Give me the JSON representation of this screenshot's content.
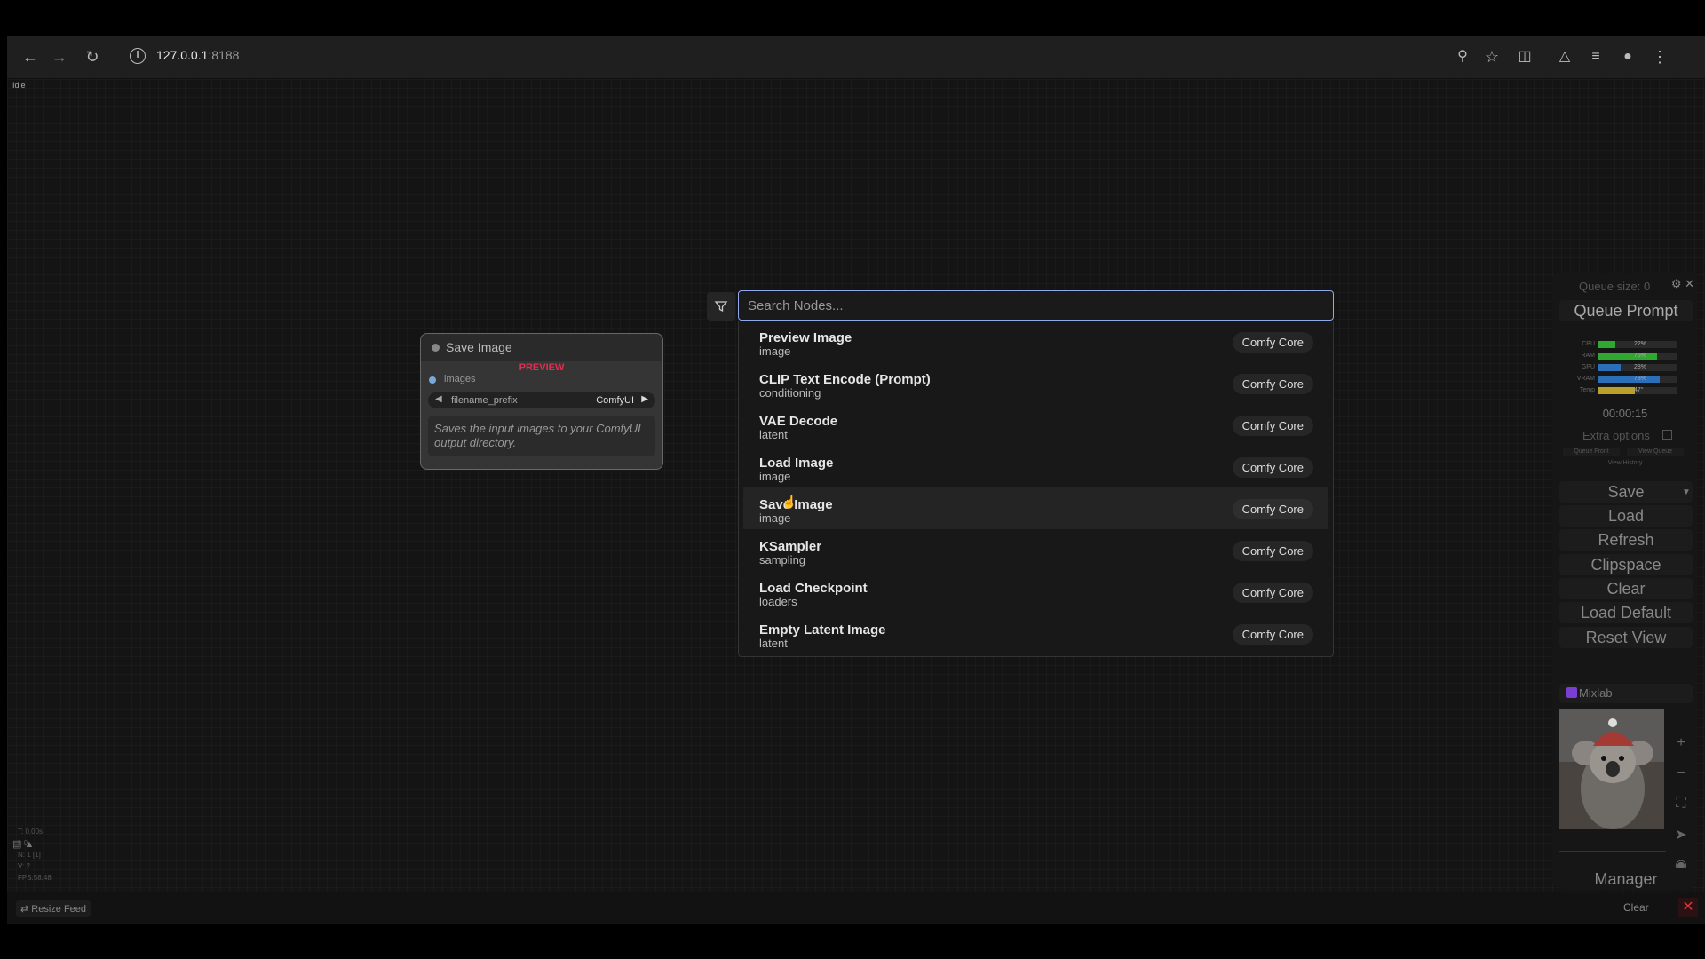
{
  "browser": {
    "url_host": "127.0.0.1",
    "url_port": ":8188",
    "icons": [
      "back-icon",
      "forward-icon",
      "reload-icon",
      "site-info-icon",
      "zoom-icon",
      "bookmark-star-icon",
      "extensions-icon",
      "labs-icon",
      "media-icon",
      "profile-icon",
      "menu-icon"
    ]
  },
  "status": {
    "idle": "Idle"
  },
  "node": {
    "title": "Save Image",
    "preview_label": "PREVIEW",
    "input_label": "images",
    "widget_name": "filename_prefix",
    "widget_value": "ComfyUI",
    "description": "Saves the input images to your ComfyUI output directory."
  },
  "search": {
    "placeholder": "Search Nodes...",
    "results": [
      {
        "name": "Preview Image",
        "category": "image",
        "source": "Comfy Core"
      },
      {
        "name": "CLIP Text Encode (Prompt)",
        "category": "conditioning",
        "source": "Comfy Core"
      },
      {
        "name": "VAE Decode",
        "category": "latent",
        "source": "Comfy Core"
      },
      {
        "name": "Load Image",
        "category": "image",
        "source": "Comfy Core"
      },
      {
        "name": "Save Image",
        "category": "image",
        "source": "Comfy Core",
        "hovered": true
      },
      {
        "name": "KSampler",
        "category": "sampling",
        "source": "Comfy Core"
      },
      {
        "name": "Load Checkpoint",
        "category": "loaders",
        "source": "Comfy Core"
      },
      {
        "name": "Empty Latent Image",
        "category": "latent",
        "source": "Comfy Core"
      }
    ]
  },
  "menu": {
    "queue_size": "Queue size: 0",
    "queue_prompt": "Queue Prompt",
    "stats": [
      {
        "label": "CPU",
        "pct": "22%",
        "value": 0.22,
        "color": "#2fa82f"
      },
      {
        "label": "RAM",
        "pct": "75%",
        "value": 0.75,
        "color": "#2fa82f"
      },
      {
        "label": "GPU",
        "pct": "28%",
        "value": 0.28,
        "color": "#2a6fb8"
      },
      {
        "label": "VRAM",
        "pct": "78%",
        "value": 0.78,
        "color": "#2a6fb8"
      },
      {
        "label": "Temp",
        "pct": "47°",
        "value": 0.47,
        "color": "#b8a02a"
      }
    ],
    "timer": "00:00:15",
    "extra_options": "Extra options",
    "queue_front": "Queue Front",
    "view_queue": "View Queue",
    "view_history": "View History",
    "save": "Save",
    "load": "Load",
    "refresh": "Refresh",
    "clipspace": "Clipspace",
    "clear": "Clear",
    "load_default": "Load Default",
    "reset_view": "Reset View",
    "mixlab": "Mixlab",
    "manager": "Manager"
  },
  "bottom": {
    "resize_feed": "Resize Feed",
    "clear": "Clear",
    "fps_lines": [
      "T: 0.00s",
      "I: 0",
      "N: 1 [1]",
      "V: 2",
      "FPS:58.48"
    ]
  }
}
